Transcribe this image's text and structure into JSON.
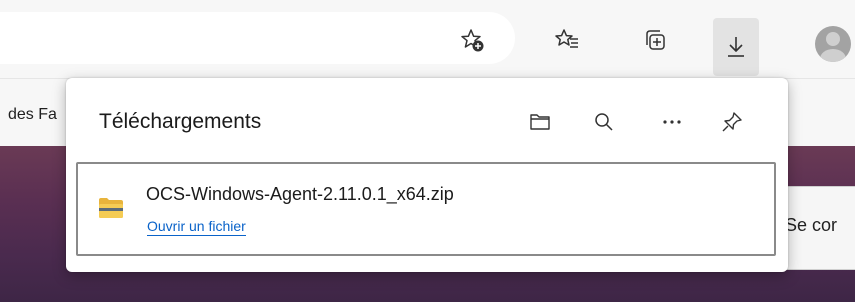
{
  "toolbar": {
    "buttons": [
      {
        "name": "add-favorite-button",
        "icon": "star-add-icon"
      },
      {
        "name": "favorites-button",
        "icon": "favorites-list-icon"
      },
      {
        "name": "collections-button",
        "icon": "collections-icon"
      },
      {
        "name": "downloads-button",
        "icon": "download-arrow-icon",
        "active": true
      },
      {
        "name": "profile-button",
        "icon": "avatar"
      }
    ]
  },
  "bookmarks": {
    "partial_text": "des Fa"
  },
  "page": {
    "partial_button_text": "Se cor"
  },
  "downloads": {
    "title": "Téléchargements",
    "actions": [
      "folder-icon",
      "search-icon",
      "more-icon",
      "pin-icon"
    ],
    "items": [
      {
        "filename": "OCS-Windows-Agent-2.11.0.1_x64.zip",
        "action_label": "Ouvrir un fichier",
        "icon": "zip-folder-icon"
      }
    ]
  },
  "colors": {
    "link": "#0a63c9",
    "page_bg": "#5a2f52",
    "item_border": "#8a8a8a"
  }
}
